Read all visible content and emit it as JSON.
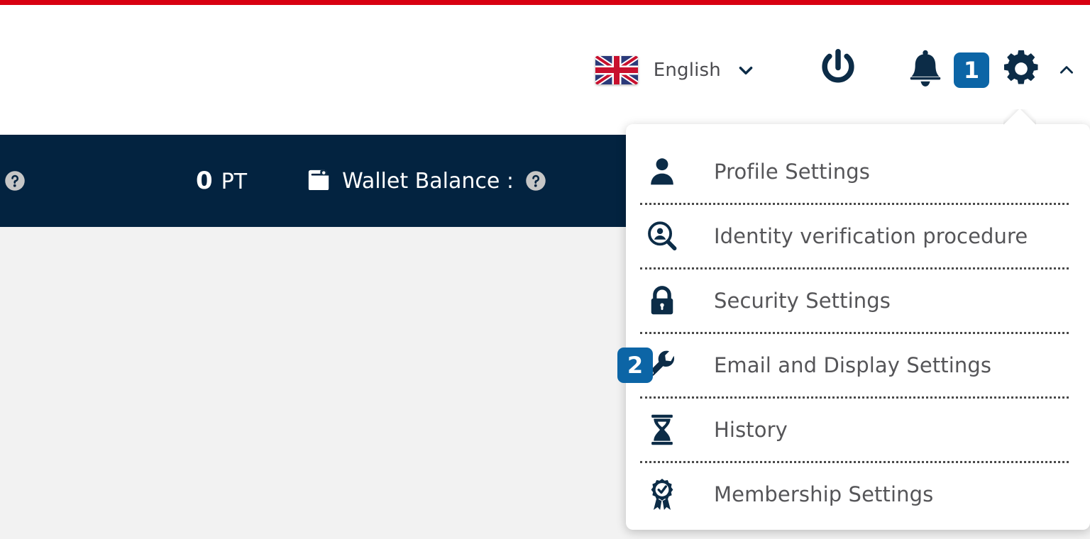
{
  "theme": {
    "accent_red": "#d80011",
    "navy": "#032340",
    "badge_blue": "#0c65a6",
    "icon_navy": "#0c2c47",
    "page_bg": "#f2f2f2",
    "menu_text": "#555558"
  },
  "header": {
    "language": {
      "flag_icon": "uk-flag-icon",
      "label": "English",
      "chevron_icon": "chevron-down-icon"
    },
    "power_icon": "power-icon",
    "notifications_icon": "bell-icon",
    "notification_badge": "1",
    "settings_icon": "gear-icon",
    "collapse_icon": "chevron-up-icon"
  },
  "navbar": {
    "help_icon_left": "help-circle-icon",
    "points": {
      "value": "0",
      "unit": "PT"
    },
    "wallet": {
      "icon": "wallet-icon",
      "label": "Wallet Balance :",
      "help_icon": "help-circle-icon"
    }
  },
  "settings_menu": {
    "step_badge": "2",
    "step_badge_item_index": 3,
    "items": [
      {
        "label": "Profile Settings",
        "icon": "user-icon"
      },
      {
        "label": "Identity verification procedure",
        "icon": "identity-search-icon"
      },
      {
        "label": "Security Settings",
        "icon": "lock-icon"
      },
      {
        "label": "Email and Display Settings",
        "icon": "wrench-icon"
      },
      {
        "label": "History",
        "icon": "hourglass-icon"
      },
      {
        "label": "Membership Settings",
        "icon": "award-ribbon-icon"
      }
    ]
  }
}
